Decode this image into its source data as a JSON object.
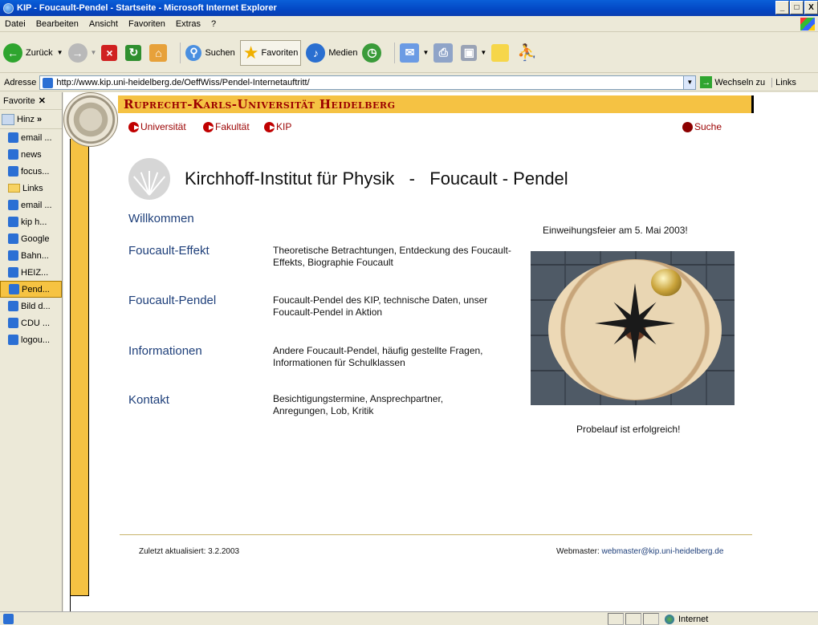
{
  "window": {
    "title": "KIP - Foucault-Pendel - Startseite - Microsoft Internet Explorer",
    "buttons": [
      "_",
      "□",
      "X"
    ]
  },
  "menu": [
    "Datei",
    "Bearbeiten",
    "Ansicht",
    "Favoriten",
    "Extras",
    "?"
  ],
  "toolbar": {
    "back": "Zurück",
    "search": "Suchen",
    "favorites": "Favoriten",
    "media": "Medien"
  },
  "address": {
    "label": "Adresse",
    "url": "http://www.kip.uni-heidelberg.de/OeffWiss/Pendel-Internetauftritt/",
    "go": "Wechseln zu",
    "links": "Links"
  },
  "favorites_pane": {
    "title": "Favorite",
    "close": "✕",
    "add": "Hinz",
    "more": "»",
    "items": [
      {
        "label": "email ...",
        "type": "page",
        "selected": false
      },
      {
        "label": "news",
        "type": "page",
        "selected": false
      },
      {
        "label": "focus...",
        "type": "page",
        "selected": false
      },
      {
        "label": "Links",
        "type": "folder",
        "selected": false
      },
      {
        "label": "email ...",
        "type": "page",
        "selected": false
      },
      {
        "label": "kip h...",
        "type": "page",
        "selected": false
      },
      {
        "label": "Google",
        "type": "page",
        "selected": false
      },
      {
        "label": "Bahn...",
        "type": "page",
        "selected": false
      },
      {
        "label": "HEIZ...",
        "type": "page",
        "selected": false
      },
      {
        "label": "Pend...",
        "type": "page",
        "selected": true
      },
      {
        "label": "Bild d...",
        "type": "page",
        "selected": false
      },
      {
        "label": "CDU ...",
        "type": "page",
        "selected": false
      },
      {
        "label": "logou...",
        "type": "page",
        "selected": false
      }
    ]
  },
  "page": {
    "university": "Ruprecht-Karls-Universität Heidelberg",
    "nav": {
      "universitaet": "Universität",
      "fakultaet": "Fakultät",
      "kip": "KIP",
      "suche": "Suche"
    },
    "title": "Kirchhoff-Institut für Physik   -   Foucault - Pendel",
    "welcome": "Willkommen",
    "sections": [
      {
        "title": "Foucault-Effekt",
        "desc": "Theoretische Betrachtungen, Entdeckung des Foucault-Effekts, Biographie Foucault"
      },
      {
        "title": "Foucault-Pendel",
        "desc": "Foucault-Pendel des KIP, technische Daten, unser Foucault-Pendel in Aktion"
      },
      {
        "title": "Informationen",
        "desc": "Andere Foucault-Pendel, häufig gestellte Fragen, Informationen für Schulklassen"
      },
      {
        "title": "Kontakt",
        "desc": "Besichtigungstermine, Ansprechpartner, Anregungen, Lob, Kritik"
      }
    ],
    "event_caption": "Einweihungsfeier am 5. Mai 2003!",
    "photo_caption": "Probelauf ist erfolgreich!",
    "last_updated": "Zuletzt aktualisiert: 3.2.2003",
    "webmaster_label": "Webmaster: ",
    "webmaster_email": "webmaster@kip.uni-heidelberg.de"
  },
  "status": {
    "zone": "Internet"
  },
  "colors": {
    "brand_yellow": "#f5c243",
    "brand_red": "#9b0000",
    "link_blue": "#1e3f7a",
    "xp_titlebar": "#0347c4"
  }
}
